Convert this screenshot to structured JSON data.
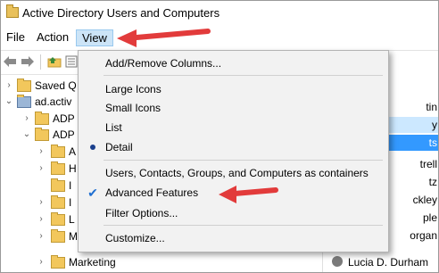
{
  "window": {
    "title": "Active Directory Users and Computers"
  },
  "menubar": {
    "file": "File",
    "action": "Action",
    "view": "View"
  },
  "tree": {
    "saved_queries": "Saved Q",
    "domain": "ad.activ",
    "ou1": "ADP",
    "ou2": "ADP",
    "child1": "A",
    "child2": "H",
    "child3": "I",
    "child4": "I",
    "child5": "L",
    "child6": "M",
    "child7": "Marketing"
  },
  "right_pane": {
    "rows": [
      "tin",
      "y",
      "ts",
      "trell",
      "tz",
      "ckley",
      "ple",
      "organ",
      "Lucia D. Durham"
    ]
  },
  "view_menu": {
    "add_remove_columns": "Add/Remove Columns...",
    "large_icons": "Large Icons",
    "small_icons": "Small Icons",
    "list": "List",
    "detail": "Detail",
    "users_contacts": "Users, Contacts, Groups, and Computers as containers",
    "advanced_features": "Advanced Features",
    "filter_options": "Filter Options...",
    "customize": "Customize..."
  },
  "colors": {
    "arrow": "#e23b3b",
    "menu_highlight": "#cce4f7",
    "selection": "#3399ff"
  }
}
